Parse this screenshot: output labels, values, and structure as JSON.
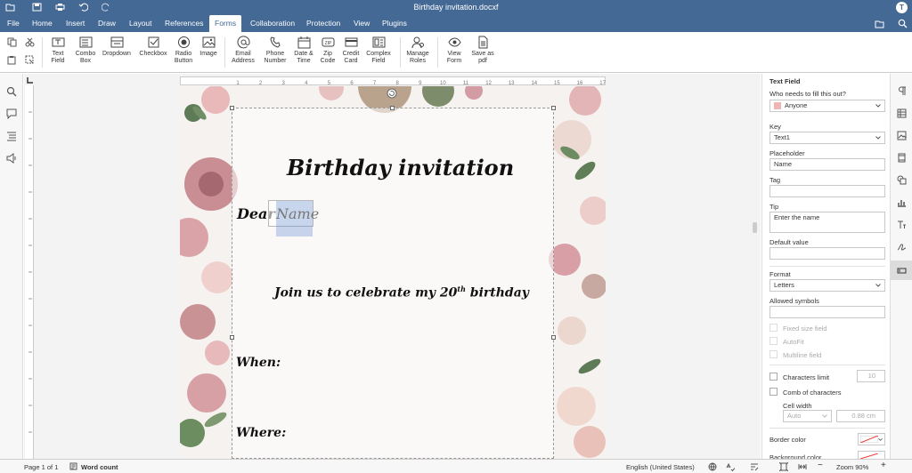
{
  "window": {
    "title": "Birthday invitation.docxf",
    "user_initial": "T"
  },
  "menu": {
    "tabs": [
      "File",
      "Home",
      "Insert",
      "Draw",
      "Layout",
      "References",
      "Forms",
      "Collaboration",
      "Protection",
      "View",
      "Plugins"
    ],
    "active": "Forms"
  },
  "toolbar": {
    "text_field": "Text\nField",
    "combo_box": "Combo\nBox",
    "dropdown": "Dropdown",
    "checkbox": "Checkbox",
    "radio_button": "Radio\nButton",
    "image": "Image",
    "email_address": "Email\nAddress",
    "phone_number": "Phone\nNumber",
    "date_time": "Date &\nTime",
    "zip_code": "Zip\nCode",
    "credit_card": "Credit\nCard",
    "complex_field": "Complex\nField",
    "manage_roles": "Manage\nRoles",
    "view_form": "View\nForm",
    "save_as_pdf": "Save as\npdf"
  },
  "document": {
    "heading": "Birthday invitation",
    "dear": "Dear",
    "field_placeholder": "Name",
    "join_text": "Join us to celebrate my 20",
    "join_sup": "th",
    "join_tail": " birthday",
    "when": "When:",
    "where": "Where:"
  },
  "panel": {
    "title": "Text Field",
    "who_label": "Who needs to fill this out?",
    "who_value": "Anyone",
    "who_color": "#f0b4b4",
    "key_label": "Key",
    "key_value": "Text1",
    "placeholder_label": "Placeholder",
    "placeholder_value": "Name",
    "tag_label": "Tag",
    "tag_value": "",
    "tip_label": "Tip",
    "tip_value": "Enter the name",
    "default_label": "Default value",
    "default_value": "",
    "format_label": "Format",
    "format_value": "Letters",
    "allowed_label": "Allowed symbols",
    "allowed_value": "",
    "fixed_size": "Fixed size field",
    "autofit": "AutoFit",
    "multiline": "Multiline field",
    "char_limit": "Characters limit",
    "char_limit_value": "10",
    "comb": "Comb of characters",
    "cell_width_label": "Cell width",
    "cell_width_mode": "Auto",
    "cell_width_value": "0.88 cm",
    "border_color": "Border color",
    "background_color": "Background color"
  },
  "ruler": {
    "h_ticks": [
      "1",
      "2",
      "3",
      "4",
      "5",
      "6",
      "7",
      "8",
      "9",
      "10",
      "11",
      "12",
      "13",
      "14",
      "15",
      "16",
      "17"
    ]
  },
  "status": {
    "page": "Page 1 of 1",
    "word_count": "Word count",
    "language": "English (United States)",
    "zoom": "Zoom 90%"
  }
}
